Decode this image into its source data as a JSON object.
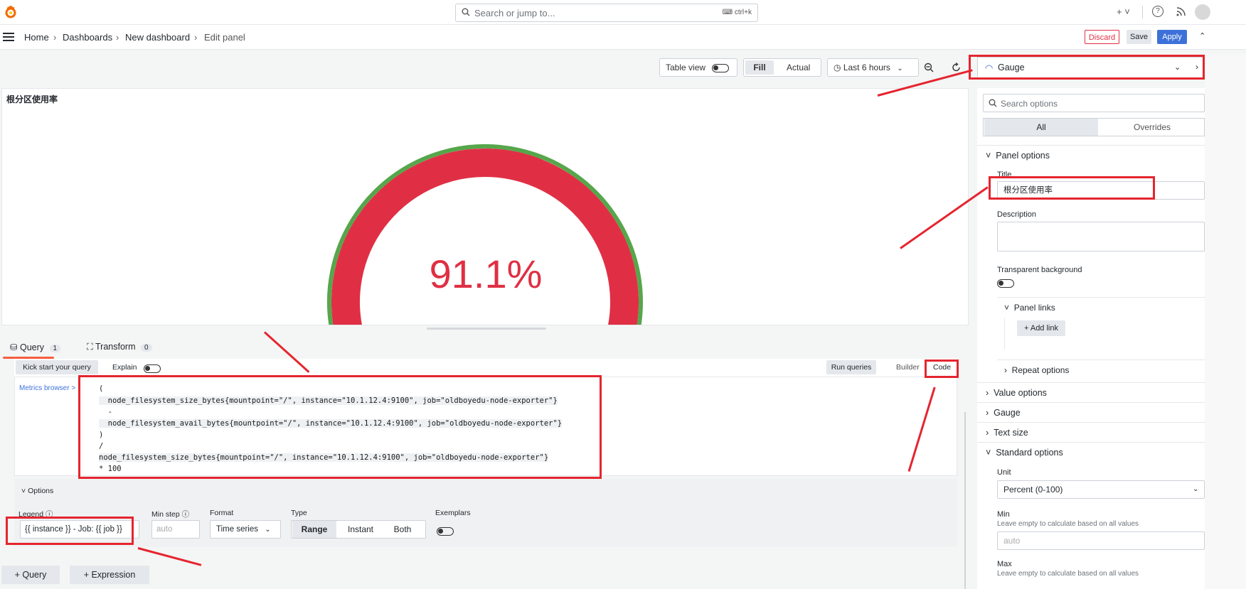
{
  "topbar": {
    "search_placeholder": "Search or jump to...",
    "shortcut": "ctrl+k",
    "plus": "+ ˅",
    "help_icon": "?",
    "rss_icon": "rss"
  },
  "breadcrumb": {
    "home": "Home",
    "dashboards": "Dashboards",
    "new_dashboard": "New dashboard",
    "edit_panel": "Edit panel",
    "sep": "›"
  },
  "actions": {
    "discard": "Discard",
    "save": "Save",
    "apply": "Apply"
  },
  "toolbar": {
    "table_view": "Table view",
    "fill": "Fill",
    "actual": "Actual",
    "time_range": "Last 6 hours",
    "viz_type": "Gauge"
  },
  "panel": {
    "title": "根分区使用率",
    "value": "91.1%",
    "gauge_fraction": 0.911
  },
  "query_tabs": {
    "query_label": "Query",
    "query_count": "1",
    "transform_label": "Transform",
    "transform_count": "0"
  },
  "query_editor": {
    "kick_start": "Kick start your query",
    "explain": "Explain",
    "run_queries": "Run queries",
    "builder": "Builder",
    "code": "Code",
    "metrics_browser": "Metrics browser >",
    "lines": [
      "(",
      "  node_filesystem_size_bytes{mountpoint=\"/\", instance=\"10.1.12.4:9100\", job=\"oldboyedu-node-exporter\"}",
      "  -",
      "  node_filesystem_avail_bytes{mountpoint=\"/\", instance=\"10.1.12.4:9100\", job=\"oldboyedu-node-exporter\"}",
      ")",
      "/",
      "node_filesystem_size_bytes{mountpoint=\"/\", instance=\"10.1.12.4:9100\", job=\"oldboyedu-node-exporter\"}",
      "* 100"
    ]
  },
  "options": {
    "header": "Options",
    "legend_label": "Legend",
    "legend_value": "{{ instance }} - Job: {{ job }}",
    "min_step_label": "Min step",
    "min_step_placeholder": "auto",
    "format_label": "Format",
    "format_value": "Time series",
    "type_label": "Type",
    "type_range": "Range",
    "type_instant": "Instant",
    "type_both": "Both",
    "exemplars_label": "Exemplars"
  },
  "bottom_buttons": {
    "add_query": "+ Query",
    "add_expression": "+ Expression"
  },
  "right_pane": {
    "search_placeholder": "Search options",
    "tab_all": "All",
    "tab_overrides": "Overrides",
    "panel_options": "Panel options",
    "title_label": "Title",
    "title_value": "根分区使用率",
    "description_label": "Description",
    "transparent_label": "Transparent background",
    "panel_links": "Panel links",
    "add_link": "+ Add link",
    "repeat_options": "Repeat options",
    "value_options": "Value options",
    "gauge": "Gauge",
    "text_size": "Text size",
    "standard_options": "Standard options",
    "unit_label": "Unit",
    "unit_value": "Percent (0-100)",
    "min_label": "Min",
    "min_help": "Leave empty to calculate based on all values",
    "min_placeholder": "auto",
    "max_label": "Max",
    "max_help": "Leave empty to calculate based on all values"
  },
  "colors": {
    "accent_blue": "#3d71d9",
    "gauge_red": "#e02f44",
    "gauge_green": "#56a64b",
    "annotation_red": "#e5252f"
  }
}
